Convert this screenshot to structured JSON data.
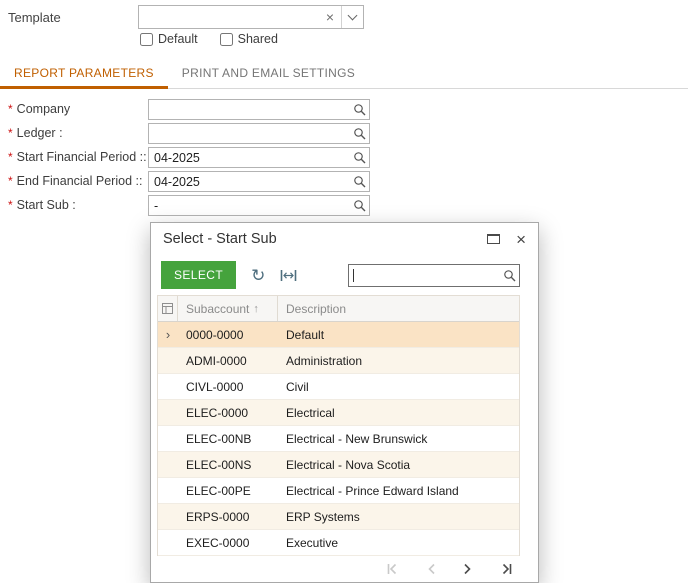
{
  "colors": {
    "accent_orange": "#c05f00",
    "button_green": "#45a33d",
    "selected_row_bg": "#fae3c5",
    "required_red": "#cc1111"
  },
  "template_section": {
    "label": "Template",
    "combo_value": "",
    "clear_icon": "×",
    "options": [
      {
        "label": "Default",
        "checked": false
      },
      {
        "label": "Shared",
        "checked": false
      }
    ]
  },
  "tabs": [
    {
      "label": "REPORT PARAMETERS"
    },
    {
      "label": "PRINT AND EMAIL SETTINGS"
    }
  ],
  "form": {
    "required_marker": "*",
    "fields": [
      {
        "label": "Company",
        "value": ""
      },
      {
        "label": "Ledger :",
        "value": ""
      },
      {
        "label": "Start Financial Period ::",
        "value": "04-2025"
      },
      {
        "label": "End Financial Period ::",
        "value": "04-2025"
      },
      {
        "label": "Start Sub :",
        "value": "-"
      }
    ]
  },
  "dialog": {
    "title": "Select - Start Sub",
    "close_icon": "×",
    "toolbar": {
      "select_label": "SELECT",
      "refresh_glyph": "↻",
      "search_value": ""
    },
    "table": {
      "columns": [
        {
          "label": "Subaccount",
          "sort": "↑"
        },
        {
          "label": "Description",
          "sort": ""
        }
      ],
      "row_arrow": "›",
      "rows": [
        {
          "subaccount": "0000-0000",
          "description": "Default",
          "selected": true
        },
        {
          "subaccount": "ADMI-0000",
          "description": "Administration",
          "selected": false
        },
        {
          "subaccount": "CIVL-0000",
          "description": "Civil",
          "selected": false
        },
        {
          "subaccount": "ELEC-0000",
          "description": "Electrical",
          "selected": false
        },
        {
          "subaccount": "ELEC-00NB",
          "description": "Electrical - New Brunswick",
          "selected": false
        },
        {
          "subaccount": "ELEC-00NS",
          "description": "Electrical - Nova Scotia",
          "selected": false
        },
        {
          "subaccount": "ELEC-00PE",
          "description": "Electrical - Prince Edward Island",
          "selected": false
        },
        {
          "subaccount": "ERPS-0000",
          "description": "ERP Systems",
          "selected": false
        },
        {
          "subaccount": "EXEC-0000",
          "description": "Executive",
          "selected": false
        }
      ]
    }
  }
}
